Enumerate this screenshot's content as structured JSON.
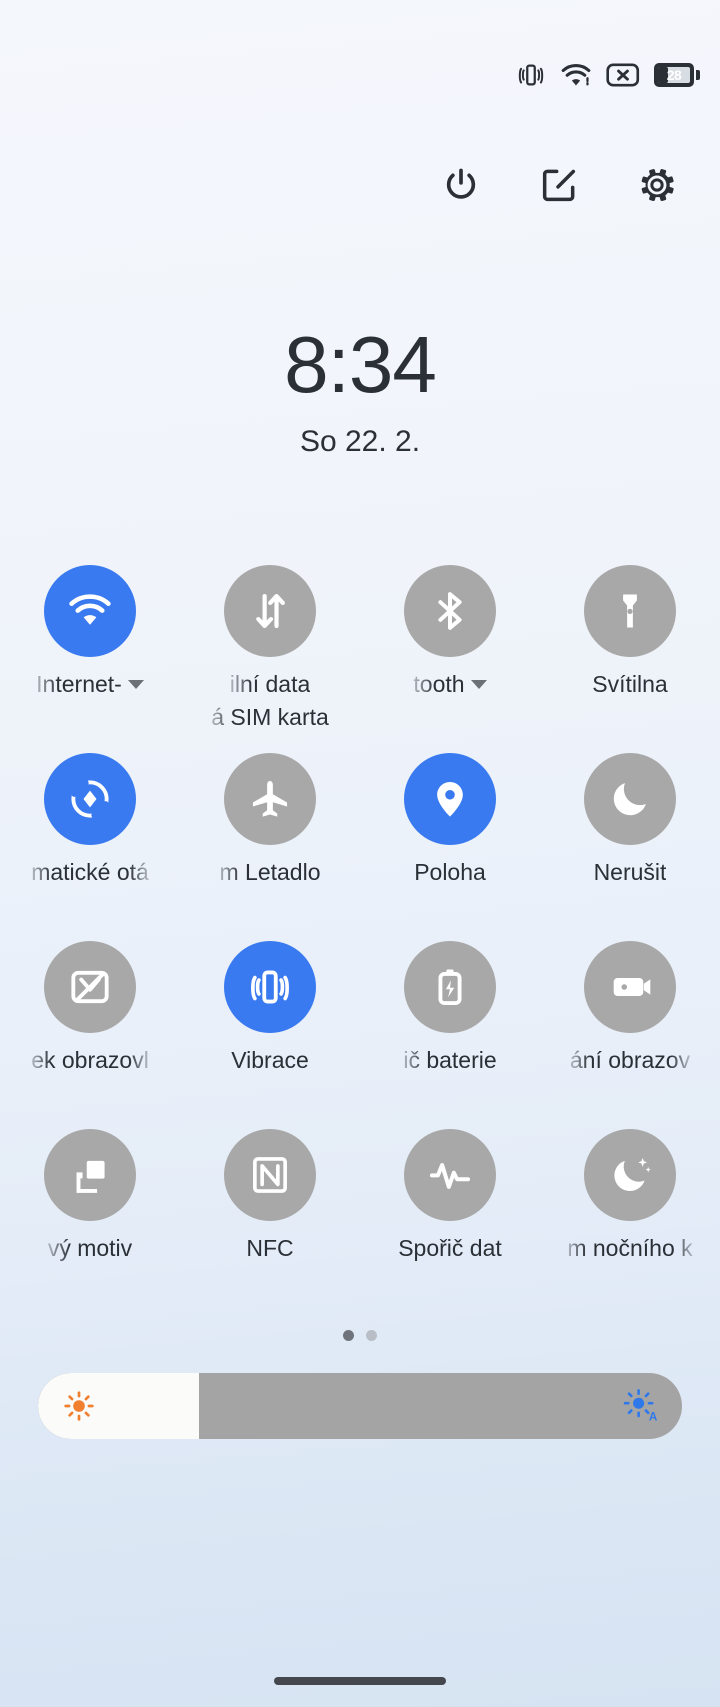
{
  "status_bar": {
    "icons": [
      {
        "name": "vibrate-icon",
        "label": "Vibrate"
      },
      {
        "name": "wifi-icon",
        "label": "Wi-Fi"
      },
      {
        "name": "no-sim-icon",
        "label": "No SIM"
      }
    ],
    "battery": {
      "percent": "28",
      "name": "battery-icon"
    }
  },
  "action_bar": {
    "buttons": [
      {
        "name": "power-button",
        "label": "Power"
      },
      {
        "name": "edit-button",
        "label": "Edit"
      },
      {
        "name": "settings-button",
        "label": "Settings"
      }
    ]
  },
  "clock": {
    "time": "8:34",
    "date": "So 22. 2."
  },
  "tiles": [
    {
      "label": "Internet-",
      "sub": "",
      "icon": "wifi-icon",
      "state": "on",
      "caret": true,
      "clip": "clip-left"
    },
    {
      "label": "ilní data",
      "sub": "á SIM karta",
      "icon": "mobile-data-icon",
      "state": "off",
      "caret": false,
      "clip": "clip-left"
    },
    {
      "label": "tooth",
      "sub": "",
      "icon": "bluetooth-icon",
      "state": "off",
      "caret": true,
      "clip": "clip-left"
    },
    {
      "label": "Svítilna",
      "sub": "",
      "icon": "flashlight-icon",
      "state": "off",
      "caret": false,
      "clip": ""
    },
    {
      "label": "matické otá",
      "sub": "",
      "icon": "auto-rotate-icon",
      "state": "on",
      "caret": false,
      "clip": "clip-both"
    },
    {
      "label": "m Letadlo",
      "sub": "",
      "icon": "airplane-icon",
      "state": "off",
      "caret": false,
      "clip": "clip-left"
    },
    {
      "label": "Poloha",
      "sub": "",
      "icon": "location-icon",
      "state": "on",
      "caret": false,
      "clip": ""
    },
    {
      "label": "Nerušit",
      "sub": "",
      "icon": "do-not-disturb-icon",
      "state": "off",
      "caret": false,
      "clip": ""
    },
    {
      "label": "ek obrazovl",
      "sub": "",
      "icon": "screenshot-icon",
      "state": "off",
      "caret": false,
      "clip": "clip-both"
    },
    {
      "label": "Vibrace",
      "sub": "",
      "icon": "vibrate-icon",
      "state": "on",
      "caret": false,
      "clip": ""
    },
    {
      "label": "ič baterie",
      "sub": "",
      "icon": "battery-saver-icon",
      "state": "off",
      "caret": false,
      "clip": "clip-left"
    },
    {
      "label": "ání obrazov",
      "sub": "",
      "icon": "screen-record-icon",
      "state": "off",
      "caret": false,
      "clip": "clip-both"
    },
    {
      "label": "vý motiv",
      "sub": "",
      "icon": "dark-theme-icon",
      "state": "off",
      "caret": false,
      "clip": "clip-left"
    },
    {
      "label": "NFC",
      "sub": "",
      "icon": "nfc-icon",
      "state": "off",
      "caret": false,
      "clip": ""
    },
    {
      "label": "Spořič dat",
      "sub": "",
      "icon": "data-saver-icon",
      "state": "off",
      "caret": false,
      "clip": ""
    },
    {
      "label": "m nočního k",
      "sub": "",
      "icon": "night-light-icon",
      "state": "off",
      "caret": false,
      "clip": "clip-both"
    }
  ],
  "pager": {
    "total": 2,
    "active_index": 0
  },
  "brightness": {
    "value_percent": 25,
    "left_icon": "brightness-low-icon",
    "right_icon": "brightness-auto-icon"
  },
  "colors": {
    "accent_on": "#3a7af0",
    "tile_off": "#a8a8a8",
    "text": "#2b2f36",
    "slider_track": "#a4a4a4",
    "slider_fill": "#fbfbf9",
    "brightness_low": "#f08030",
    "brightness_auto": "#3a7af0"
  },
  "navigation": {
    "home_indicator": "home-indicator"
  }
}
